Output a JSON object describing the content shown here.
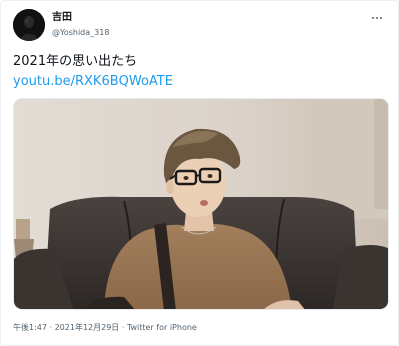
{
  "tweet": {
    "author": {
      "display_name": "吉田",
      "handle": "@Yoshida_318"
    },
    "more_label": "•••",
    "text": "2021年の思い出たち",
    "link": "youtu.be/RXK6BQWoATE",
    "meta": "午後1:47 · 2021年12月29日 · Twitter for iPhone"
  },
  "colors": {
    "link": "#1d9bf0",
    "secondary_text": "#536471",
    "primary_text": "#0f1419"
  },
  "icons": [
    "more-icon"
  ]
}
